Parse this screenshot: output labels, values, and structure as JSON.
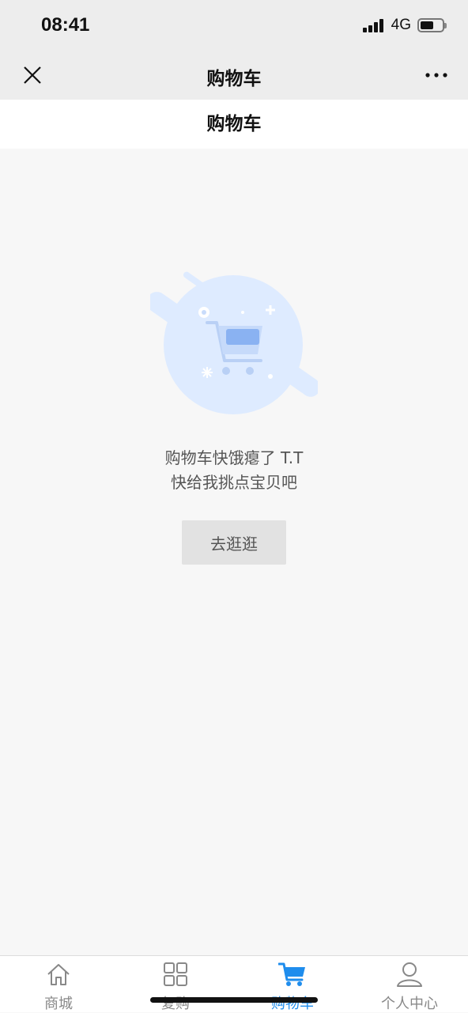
{
  "status_bar": {
    "time": "08:41",
    "network": "4G"
  },
  "nav": {
    "title": "购物车"
  },
  "page_header": {
    "title": "购物车"
  },
  "empty_state": {
    "line1": "购物车快饿瘪了 T.T",
    "line2": "快给我挑点宝贝吧",
    "button_label": "去逛逛"
  },
  "tabs": [
    {
      "label": "商城",
      "icon": "home-icon",
      "active": false
    },
    {
      "label": "复购",
      "icon": "grid-icon",
      "active": false
    },
    {
      "label": "购物车",
      "icon": "cart-icon",
      "active": true
    },
    {
      "label": "个人中心",
      "icon": "user-icon",
      "active": false
    }
  ],
  "colors": {
    "accent": "#1f8ded",
    "background": "#f7f7f7",
    "nav_bg": "#ededed",
    "illustration": "#deebff"
  }
}
